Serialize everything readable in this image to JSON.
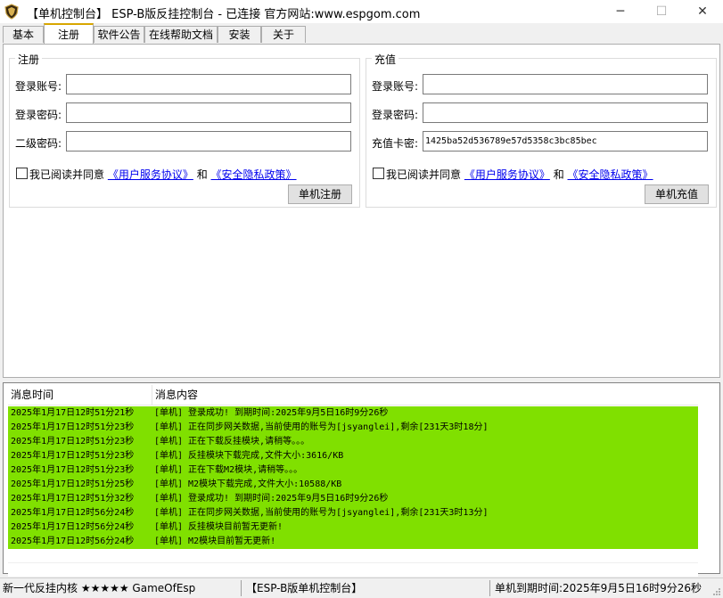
{
  "window": {
    "title": "【单机控制台】 ESP-B版反挂控制台 - 已连接    官方网站:www.espgom.com",
    "minimize": "─",
    "maximize": "☐",
    "close": "✕"
  },
  "tabs": [
    {
      "label": "基本"
    },
    {
      "label": "注册"
    },
    {
      "label": "软件公告"
    },
    {
      "label": "在线帮助文档"
    },
    {
      "label": "安装"
    },
    {
      "label": "关于"
    }
  ],
  "register": {
    "title": "注册",
    "account_label": "登录账号:",
    "account_value": "",
    "password_label": "登录密码:",
    "password_value": "",
    "second_password_label": "二级密码:",
    "second_password_value": "",
    "agree_text": "我已阅读并同意",
    "agreement_link": "《用户服务协议》",
    "and_text": "和",
    "privacy_link": "《安全隐私政策》",
    "submit_label": "单机注册"
  },
  "recharge": {
    "title": "充值",
    "account_label": "登录账号:",
    "account_value": "",
    "password_label": "登录密码:",
    "password_value": "",
    "card_label": "充值卡密:",
    "card_value": "1425ba52d536789e57d5358c3bc85bec",
    "agree_text": "我已阅读并同意",
    "agreement_link": "《用户服务协议》",
    "and_text": "和",
    "privacy_link": "《安全隐私政策》",
    "submit_label": "单机充值"
  },
  "log": {
    "col_time": "消息时间",
    "col_message": "消息内容",
    "row_color": "#80e000",
    "rows": [
      {
        "time": "2025年1月17日12时51分21秒",
        "message": "[单机] 登录成功! 到期时间:2025年9月5日16时9分26秒"
      },
      {
        "time": "2025年1月17日12时51分23秒",
        "message": "[单机] 正在同步网关数据,当前使用的账号为[jsyanglei],剩余[231天3时18分]"
      },
      {
        "time": "2025年1月17日12时51分23秒",
        "message": "[单机] 正在下载反挂模块,请稍等。。。"
      },
      {
        "time": "2025年1月17日12时51分23秒",
        "message": "[单机] 反挂模块下载完成,文件大小:3616/KB"
      },
      {
        "time": "2025年1月17日12时51分23秒",
        "message": "[单机] 正在下载M2模块,请稍等。。。"
      },
      {
        "time": "2025年1月17日12时51分25秒",
        "message": "[单机] M2模块下载完成,文件大小:10588/KB"
      },
      {
        "time": "2025年1月17日12时51分32秒",
        "message": "[单机] 登录成功! 到期时间:2025年9月5日16时9分26秒"
      },
      {
        "time": "2025年1月17日12时56分24秒",
        "message": "[单机] 正在同步网关数据,当前使用的账号为[jsyanglei],剩余[231天3时13分]"
      },
      {
        "time": "2025年1月17日12时56分24秒",
        "message": "[单机] 反挂模块目前暂无更新!"
      },
      {
        "time": "2025年1月17日12时56分24秒",
        "message": "[单机] M2模块目前暂无更新!"
      }
    ]
  },
  "status": {
    "left": "新一代反挂内核 ★★★★★ GameOfEsp",
    "middle": "【ESP-B版单机控制台】",
    "right": "单机到期时间:2025年9月5日16时9分26秒"
  }
}
